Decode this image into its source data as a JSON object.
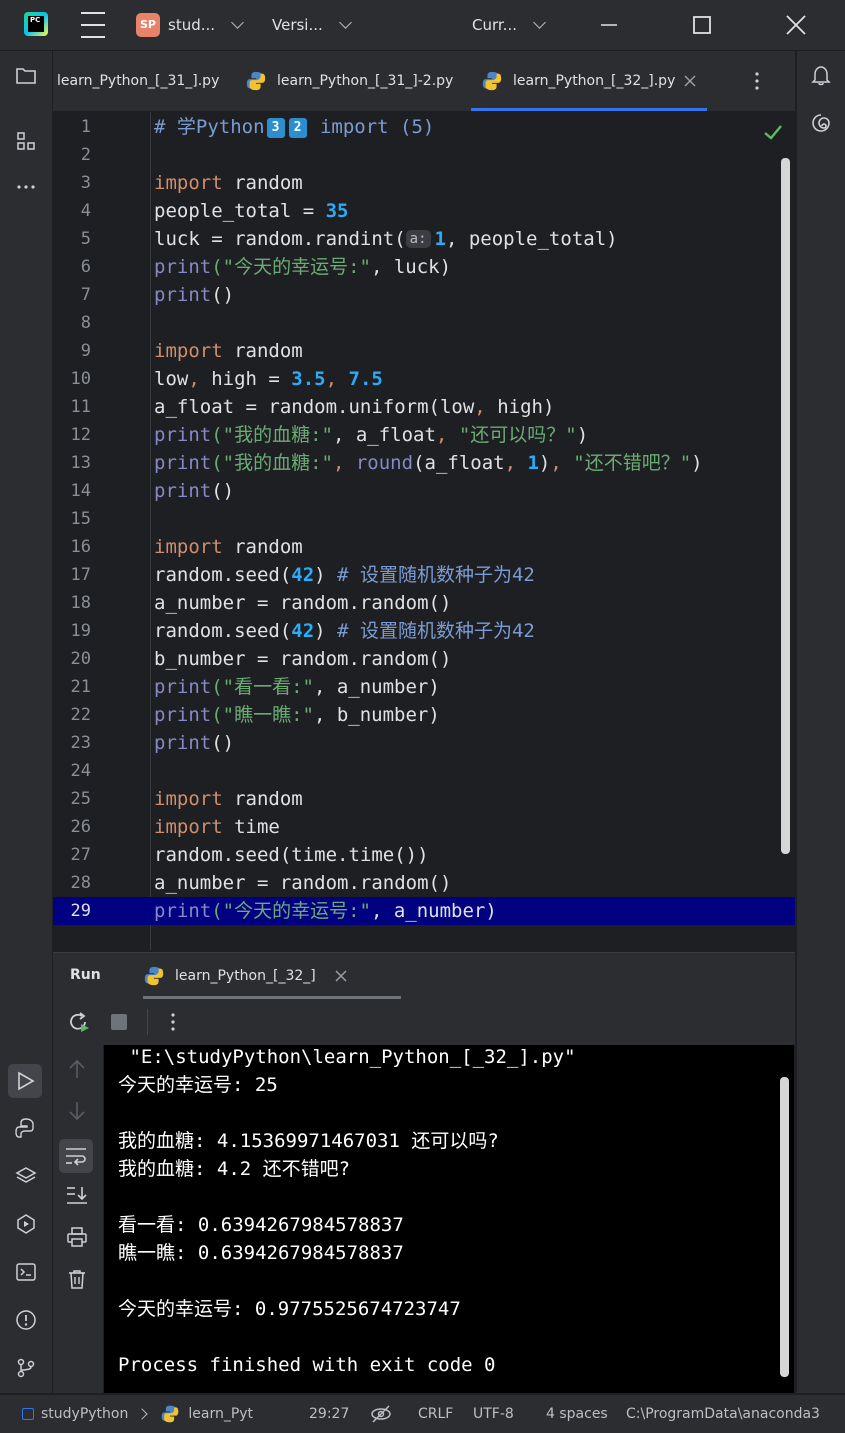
{
  "titlebar": {
    "project_badge": "SP",
    "project_name": "stud...",
    "vcs_label": "Versi...",
    "run_config": "Curr..."
  },
  "tabs": [
    {
      "label": "learn_Python_[_31_].py"
    },
    {
      "label": "learn_Python_[_31_]-2.py"
    },
    {
      "label": "learn_Python_[_32_].py"
    }
  ],
  "editor": {
    "current_line": 29,
    "line_numbers": [
      "1",
      "2",
      "3",
      "4",
      "5",
      "6",
      "7",
      "8",
      "9",
      "10",
      "11",
      "12",
      "13",
      "14",
      "15",
      "16",
      "17",
      "18",
      "19",
      "20",
      "21",
      "22",
      "23",
      "24",
      "25",
      "26",
      "27",
      "28",
      "29"
    ],
    "l1_prefix": "# 学Python",
    "l1_badge1": "3",
    "l1_badge2": "2",
    "l1_suffix": " import (5)",
    "kw_import": "import",
    "mod_random": " random",
    "mod_time": " time",
    "l4_var": "people_total = ",
    "l4_num": "35",
    "l5_a": "luck = random.randint(",
    "l5_hint": "a:",
    "l5_num": "1",
    "l5_b": ", people_total)",
    "print": "print",
    "l6_str": "(\"今天的幸运号:\"",
    "l6_rest": ", luck)",
    "empty_call": "()",
    "l10_a": "low",
    "l10_comma1": ", ",
    "l10_b": "high = ",
    "l10_n1": "3.5",
    "l10_comma2": ", ",
    "l10_n2": "7.5",
    "l11": "a_float = random.uniform(low",
    "l11_comma": ", ",
    "l11_b": "high)",
    "l12_str": "(\"我的血糖:\"",
    "l12_mid": ", a_float",
    "l12_comma": ", ",
    "l12_str2": "\"还可以吗？\"",
    "l12_end": ")",
    "l13_str": "(\"我的血糖:\"",
    "l13_comma": ", ",
    "round": "round",
    "l13_mid": "(a_float",
    "l13_comma2": ", ",
    "l13_num": "1",
    "l13_close": ")",
    "l13_comma3": ", ",
    "l13_str2": "\"还不错吧？\"",
    "l13_end": ")",
    "seed_a": "random.seed(",
    "seed_num": "42",
    "seed_b": ") ",
    "seed_cmt": "# 设置随机数种子为42",
    "l18": "a_number = random.random()",
    "l20": "b_number = random.random()",
    "l21_str": "(\"看一看:\"",
    "l21_rest": ", a_number)",
    "l22_str": "(\"瞧一瞧:\"",
    "l22_rest": ", b_number)",
    "l27": "random.seed(time.time())",
    "l28": "a_number = random.random()",
    "l29_str": "(\"今天的幸运号:\"",
    "l29_rest": ", a_number)"
  },
  "run": {
    "title": "Run",
    "tab_label": "learn_Python_[_32_]",
    "console": [
      " \"E:\\studyPython\\learn_Python_[_32_].py\"",
      "今天的幸运号: 25",
      "",
      "我的血糖: 4.15369971467031 还可以吗?",
      "我的血糖: 4.2 还不错吧?",
      "",
      "看一看: 0.6394267984578837",
      "瞧一瞧: 0.6394267984578837",
      "",
      "今天的幸运号: 0.9775525674723747",
      "",
      "Process finished with exit code 0"
    ]
  },
  "statusbar": {
    "project": "studyPython",
    "file": "learn_Pyt",
    "position": "29:27",
    "line_sep": "CRLF",
    "encoding": "UTF-8",
    "indent": "4 spaces",
    "interpreter": "C:\\ProgramData\\anaconda3"
  },
  "colors": {
    "accent": "#3574f0",
    "current_line_bg": "#000080",
    "keyword": "#cf8e6d",
    "number": "#2aacf8",
    "string": "#6aab73"
  }
}
